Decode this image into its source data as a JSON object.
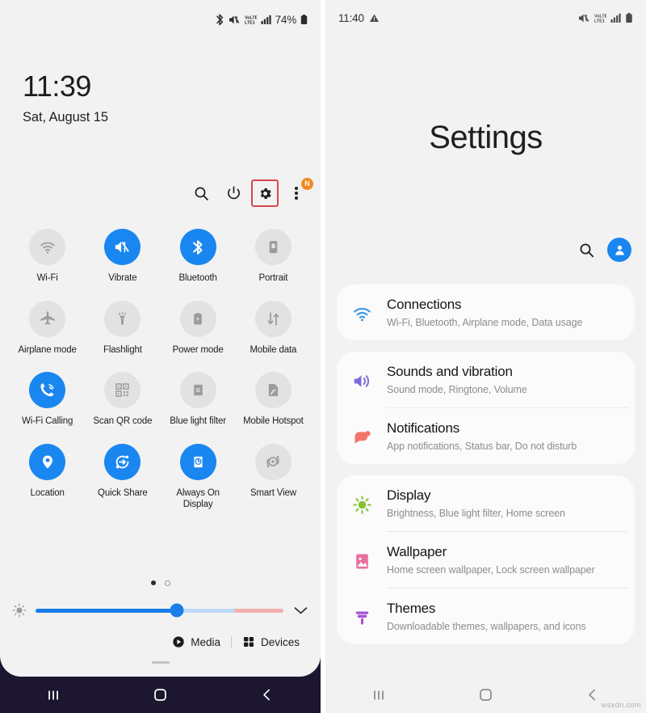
{
  "quick_settings": {
    "statusbar": {
      "icons": [
        "bluetooth-icon",
        "mute-icon",
        "volte-icon",
        "signal-icon"
      ],
      "battery_percent": "74%"
    },
    "clock": {
      "time": "11:39",
      "date": "Sat, August 15"
    },
    "actions": [
      {
        "name": "search-icon",
        "label": "Search"
      },
      {
        "name": "power-icon",
        "label": "Power off"
      },
      {
        "name": "gear-icon",
        "label": "Settings",
        "highlighted": true
      },
      {
        "name": "more-icon",
        "label": "More options",
        "badge": "N"
      }
    ],
    "tiles": [
      {
        "label": "Wi-Fi",
        "icon": "wifi-icon",
        "active": false
      },
      {
        "label": "Vibrate",
        "icon": "vibrate-icon",
        "active": true
      },
      {
        "label": "Bluetooth",
        "icon": "bluetooth-icon",
        "active": true
      },
      {
        "label": "Portrait",
        "icon": "portrait-lock-icon",
        "active": false
      },
      {
        "label": "Airplane mode",
        "icon": "airplane-icon",
        "active": false
      },
      {
        "label": "Flashlight",
        "icon": "flashlight-icon",
        "active": false
      },
      {
        "label": "Power mode",
        "icon": "power-mode-icon",
        "active": false
      },
      {
        "label": "Mobile data",
        "icon": "mobile-data-icon",
        "active": false
      },
      {
        "label": "Wi-Fi Calling",
        "icon": "wifi-calling-icon",
        "active": true
      },
      {
        "label": "Scan QR code",
        "icon": "qr-code-icon",
        "active": false
      },
      {
        "label": "Blue light filter",
        "icon": "blue-light-filter-icon",
        "active": false
      },
      {
        "label": "Mobile Hotspot",
        "icon": "hotspot-icon",
        "active": false
      },
      {
        "label": "Location",
        "icon": "location-pin-icon",
        "active": true
      },
      {
        "label": "Quick Share",
        "icon": "quick-share-icon",
        "active": true
      },
      {
        "label": "Always On Display",
        "icon": "always-on-display-icon",
        "active": true
      },
      {
        "label": "Smart View",
        "icon": "smart-view-icon",
        "active": false
      }
    ],
    "page_dots": {
      "count": 2,
      "active_index": 0
    },
    "brightness": {
      "icon": "brightness-icon",
      "value_percent": 57,
      "warm_start_percent": 80,
      "expand_icon": "chevron-down-icon"
    },
    "footer": {
      "media_label": "Media",
      "media_icon": "play-circle-icon",
      "devices_label": "Devices",
      "devices_icon": "devices-grid-icon"
    },
    "navbar": [
      {
        "name": "recents-button",
        "icon": "recents-icon"
      },
      {
        "name": "home-button",
        "icon": "home-icon"
      },
      {
        "name": "back-button",
        "icon": "back-icon"
      }
    ]
  },
  "settings": {
    "statusbar": {
      "time": "11:40",
      "left_icon": "warning-triangle-icon",
      "icons": [
        "mute-icon",
        "volte-icon",
        "signal-icon",
        "battery-icon"
      ]
    },
    "title": "Settings",
    "tools": [
      {
        "name": "search-icon",
        "label": "Search settings"
      },
      {
        "name": "profile-avatar",
        "label": "Account"
      }
    ],
    "groups": [
      {
        "rows": [
          {
            "title": "Connections",
            "subtitle": "Wi-Fi, Bluetooth, Airplane mode, Data usage",
            "icon": "wifi-icon",
            "color": "#3b9ae8"
          }
        ]
      },
      {
        "rows": [
          {
            "title": "Sounds and vibration",
            "subtitle": "Sound mode, Ringtone, Volume",
            "icon": "speaker-icon",
            "color": "#7b6ddb"
          },
          {
            "title": "Notifications",
            "subtitle": "App notifications, Status bar, Do not disturb",
            "icon": "notification-bubble-icon",
            "color": "#f4736b"
          }
        ]
      },
      {
        "rows": [
          {
            "title": "Display",
            "subtitle": "Brightness, Blue light filter, Home screen",
            "icon": "sun-icon",
            "color": "#86c232"
          },
          {
            "title": "Wallpaper",
            "subtitle": "Home screen wallpaper, Lock screen wallpaper",
            "icon": "image-icon",
            "color": "#e86f9e"
          },
          {
            "title": "Themes",
            "subtitle": "Downloadable themes, wallpapers, and icons",
            "icon": "paint-brush-icon",
            "color": "#a652d6"
          }
        ]
      }
    ],
    "navbar": [
      {
        "name": "recents-button",
        "icon": "recents-icon"
      },
      {
        "name": "home-button",
        "icon": "home-icon"
      },
      {
        "name": "back-button",
        "icon": "back-icon"
      }
    ]
  },
  "watermark": "wsxdn.com",
  "colors": {
    "accent_blue": "#1a86f0",
    "tile_off": "#e2e2e2",
    "panel_bg": "#f2f2f2",
    "navbar_dark": "#1d1630",
    "highlight_red": "#d9474b",
    "badge_orange": "#f08a1e"
  }
}
